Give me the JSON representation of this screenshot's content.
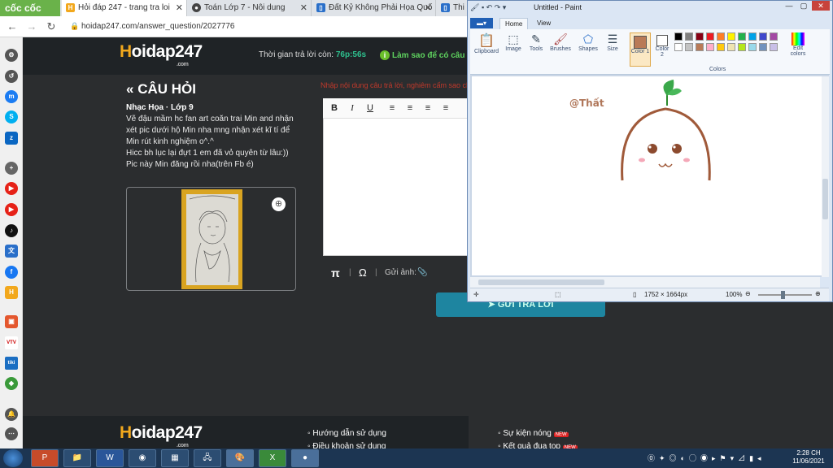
{
  "browser": {
    "brand": "cốc cốc",
    "tabs": [
      {
        "label": "Hỏi đáp 247 - trang tra loi",
        "active": true
      },
      {
        "label": "Toán Lớp 7 - Nôi dung",
        "active": false
      },
      {
        "label": "Đất Kỷ Không Phải Họa Quố",
        "active": false
      },
      {
        "label": "Thi",
        "active": false
      }
    ],
    "url": "hoidap247.com/answer_question/2027776"
  },
  "site": {
    "logo_main": "oidap247",
    "logo_h": "H",
    "logo_com": ".com",
    "timer_label": "Thời gian trả lời còn: ",
    "timer_value": "76p:56s",
    "howto": "Làm sao để có câu",
    "question_title": "CÂU HỎI",
    "meta": "Nhạc Họa · Lớp 9",
    "body_lines": [
      "Vẽ đậu mầm hc fan art coăn trai Min and nhận",
      "xét pic dưới hộ Min nha mng nhận xét kĩ tí để",
      "Min rút kinh nghiệm o^.^",
      "Hicc bh lục lại đựt 1 em đã vỏ quyên từ lâu:))",
      "Pic này Min đăng rồi nha(trên Fb é)"
    ],
    "red_hint": "Nhập nội dung câu trả lời, nghiêm cấm sao chép",
    "editor_footer_label": "Gửi ảnh:",
    "submit": "GỬI TRẢ LỜI",
    "footer": {
      "logo_main": "oidap247",
      "logo_h": "H",
      "logo_com": ".com",
      "links_left": [
        "Hướng dẫn sử dụng",
        "Điều khoản sử dụng"
      ],
      "links_right": [
        "Sự kiện nóng",
        "Kết quả đua top"
      ],
      "new_badge": "NEW"
    }
  },
  "paint": {
    "title": "Untitled - Paint",
    "tabs": [
      "Home",
      "View"
    ],
    "groups": [
      "Clipboard",
      "Image",
      "Tools",
      "Brushes",
      "Shapes",
      "Size",
      "Color 1",
      "Color 2",
      "Edit colors",
      "Colors"
    ],
    "canvas_text": "@Thất",
    "dimensions": "1752 × 1664px",
    "zoom": "100%",
    "palette": [
      "#000000",
      "#7f7f7f",
      "#880015",
      "#ed1c24",
      "#ff7f27",
      "#fff200",
      "#22b14c",
      "#00a2e8",
      "#3f48cc",
      "#a349a4",
      "#ffffff",
      "#c3c3c3",
      "#b97a57",
      "#ffaec9",
      "#ffc90e",
      "#efe4b0",
      "#b5e61d",
      "#99d9ea",
      "#7092be",
      "#c8bfe7"
    ],
    "color1": "#b97a57"
  },
  "taskbar": {
    "time": "2:28 CH",
    "date": "11/06/2021"
  }
}
